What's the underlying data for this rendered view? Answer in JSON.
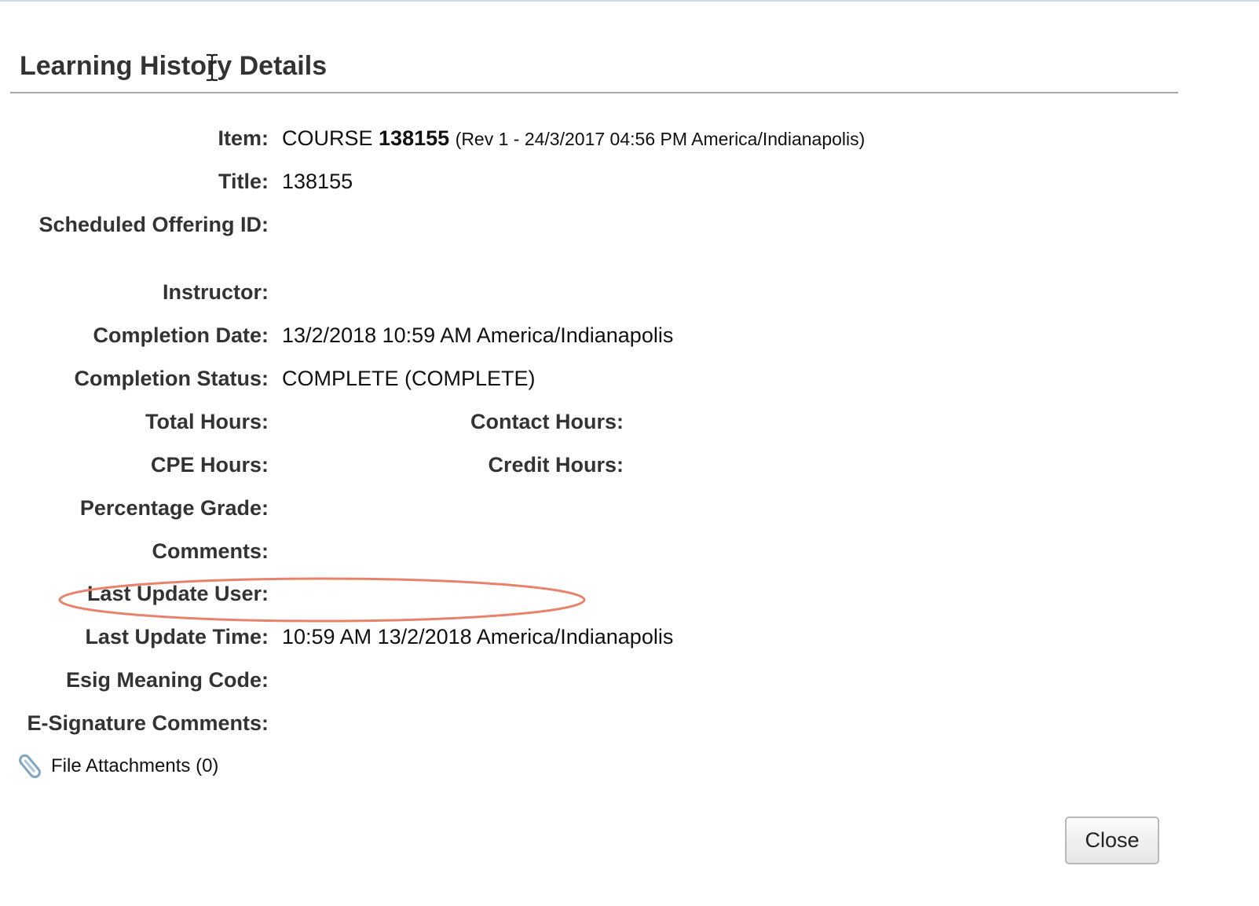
{
  "dialog": {
    "title": "Learning History Details",
    "close_label": "Close"
  },
  "fields": {
    "item": {
      "label": "Item:",
      "type_text": "COURSE",
      "code": "138155",
      "revision": "(Rev 1 - 24/3/2017 04:56 PM America/Indianapolis)"
    },
    "title": {
      "label": "Title:",
      "value": "138155"
    },
    "scheduled_offering_id": {
      "label": "Scheduled Offering ID:",
      "value": ""
    },
    "instructor": {
      "label": "Instructor:",
      "value": ""
    },
    "completion_date": {
      "label": "Completion Date:",
      "value": "13/2/2018 10:59 AM America/Indianapolis"
    },
    "completion_status": {
      "label": "Completion Status:",
      "value": "COMPLETE (COMPLETE)"
    },
    "total_hours": {
      "label": "Total Hours:",
      "value": ""
    },
    "contact_hours": {
      "label": "Contact Hours:",
      "value": ""
    },
    "cpe_hours": {
      "label": "CPE Hours:",
      "value": ""
    },
    "credit_hours": {
      "label": "Credit Hours:",
      "value": ""
    },
    "percentage_grade": {
      "label": "Percentage Grade:",
      "value": ""
    },
    "comments": {
      "label": "Comments:",
      "value": ""
    },
    "last_update_user": {
      "label": "Last Update User:",
      "value": ""
    },
    "last_update_time": {
      "label": "Last Update Time:",
      "value": "10:59 AM 13/2/2018 America/Indianapolis"
    },
    "esig_meaning_code": {
      "label": "Esig Meaning Code:",
      "value": ""
    },
    "esignature_comments": {
      "label": "E-Signature Comments:",
      "value": ""
    }
  },
  "attachments": {
    "label": "File Attachments (0)",
    "icon": "paperclip-icon"
  },
  "annotation": {
    "shape": "ellipse",
    "color": "#e8826a",
    "target": "last_update_user"
  },
  "colors": {
    "title_rule": "#a8a8a8",
    "label_text": "#333333",
    "top_strip": "#cfdce8"
  }
}
